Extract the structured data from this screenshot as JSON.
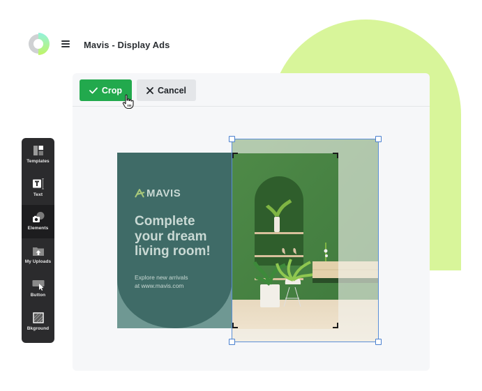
{
  "header": {
    "title": "Mavis - Display Ads",
    "logo_icon": "ring-logo-icon",
    "menu_icon": "hamburger-menu-icon"
  },
  "toolbar": {
    "crop_label": "Crop",
    "cancel_label": "Cancel",
    "crop_icon": "checkmark-icon",
    "cancel_icon": "x-close-icon",
    "crop_color": "#22a94d"
  },
  "sidebar": {
    "items": [
      {
        "label": "Templates",
        "icon": "templates-icon",
        "active": false
      },
      {
        "label": "Text",
        "icon": "text-icon",
        "active": false
      },
      {
        "label": "Elements",
        "icon": "elements-icon",
        "active": true
      },
      {
        "label": "My Uploads",
        "icon": "uploads-icon",
        "active": false
      },
      {
        "label": "Button",
        "icon": "button-icon",
        "active": false
      },
      {
        "label": "Bkground",
        "icon": "background-icon",
        "active": false
      }
    ]
  },
  "ad": {
    "brand": "MAVIS",
    "headline_lines": [
      "Complete",
      "your dream",
      "living room!"
    ],
    "sub_lines": [
      "Explore new arrivals",
      "at www.mavis.com"
    ],
    "colors": {
      "panel": "#3f6b67",
      "panel_light": "#6f9893",
      "text": "#c9d9d4",
      "accent": "#a9c97a"
    }
  },
  "colors": {
    "accent_blob": "#d8f59a",
    "crop_frame": "#5b8fd6"
  }
}
